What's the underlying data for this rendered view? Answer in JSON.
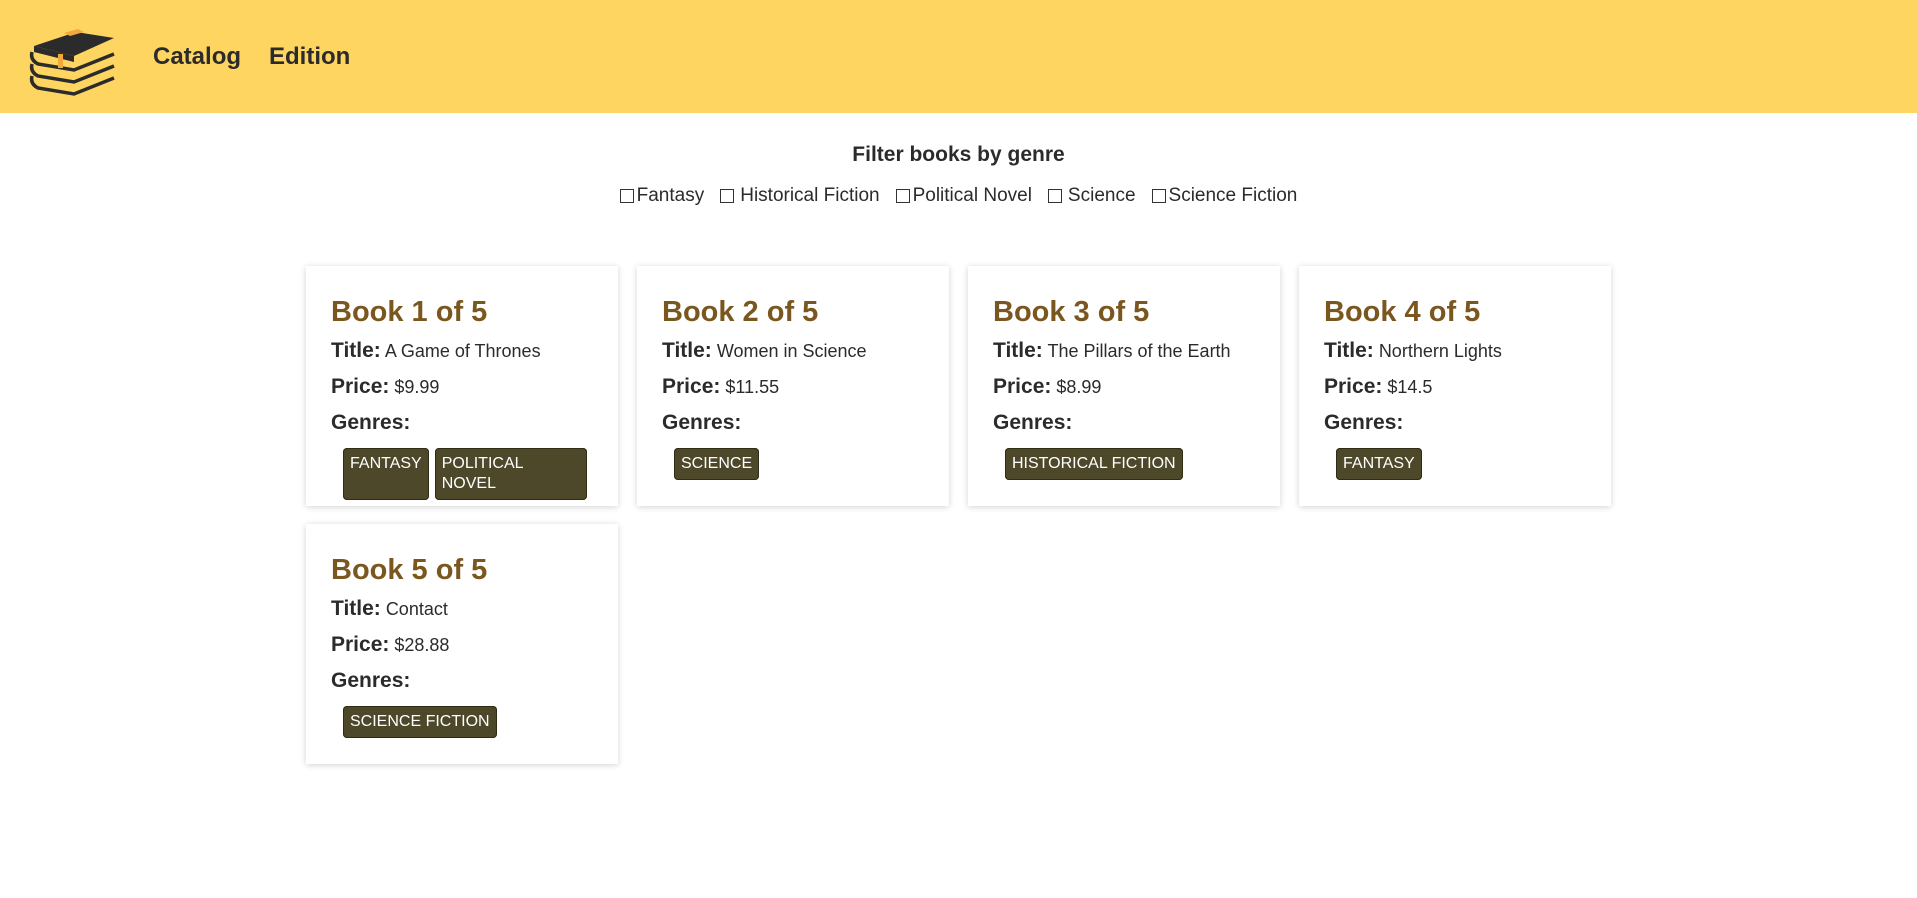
{
  "nav": {
    "catalog": "Catalog",
    "edition": "Edition"
  },
  "filter": {
    "title": "Filter books by genre",
    "options": [
      "Fantasy",
      "Historical Fiction",
      "Political Novel",
      "Science",
      "Science Fiction"
    ]
  },
  "labels": {
    "title": "Title:",
    "price": "Price:",
    "genres": "Genres:"
  },
  "books": [
    {
      "heading": "Book 1 of 5",
      "title": "A Game of Thrones",
      "price": "$9.99",
      "genres": [
        "FANTASY",
        "POLITICAL NOVEL"
      ]
    },
    {
      "heading": "Book 2 of 5",
      "title": "Women in Science",
      "price": "$11.55",
      "genres": [
        "SCIENCE"
      ]
    },
    {
      "heading": "Book 3 of 5",
      "title": "The Pillars of the Earth",
      "price": "$8.99",
      "genres": [
        "HISTORICAL FICTION"
      ]
    },
    {
      "heading": "Book 4 of 5",
      "title": "Northern Lights",
      "price": "$14.5",
      "genres": [
        "FANTASY"
      ]
    },
    {
      "heading": "Book 5 of 5",
      "title": "Contact",
      "price": "$28.88",
      "genres": [
        "SCIENCE FICTION"
      ]
    }
  ],
  "colors": {
    "header_bg": "#ffd561",
    "heading": "#7b5720",
    "tag_bg": "#4c4829"
  }
}
